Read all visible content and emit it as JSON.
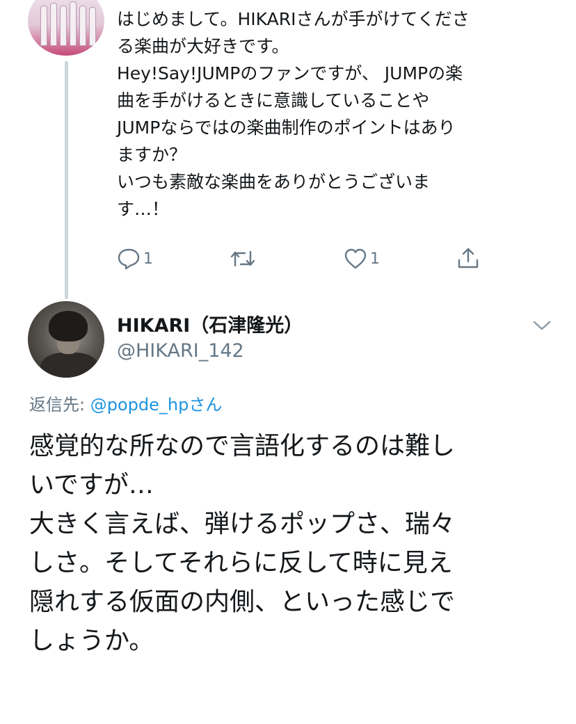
{
  "previous_tweet": {
    "lines": [
      "はじめまして。HIKARIさんが手がけてくださ",
      "る楽曲が大好きです。",
      "Hey!Say!JUMPのファンですが、 JUMPの楽",
      "曲を手がけるときに意識していることや",
      "JUMPならではの楽曲制作のポイントはあり",
      "ますか？",
      "いつも素敵な楽曲をありがとうございま",
      "す…！"
    ],
    "reply_count": "1",
    "like_count": "1",
    "icons": [
      "reply-icon",
      "retweet-icon",
      "like-icon",
      "share-icon"
    ]
  },
  "reply_tweet": {
    "display_name": "HIKARI（石津隆光）",
    "handle": "@HIKARI_142",
    "reply_to_prefix": "返信先: ",
    "reply_to_mention": "@popde_hpさん",
    "lines": [
      "感覚的な所なので言語化するのは難し",
      "いですが…",
      "大きく言えば、弾けるポップさ、瑞々",
      "しさ。そしてそれらに反して時に見え",
      "隠れする仮面の内側、といった感じで",
      "しょうか。"
    ]
  },
  "colors": {
    "text": "#14171a",
    "secondary": "#657786",
    "link": "#1b95e0",
    "thread_line": "#ccd6dd"
  }
}
